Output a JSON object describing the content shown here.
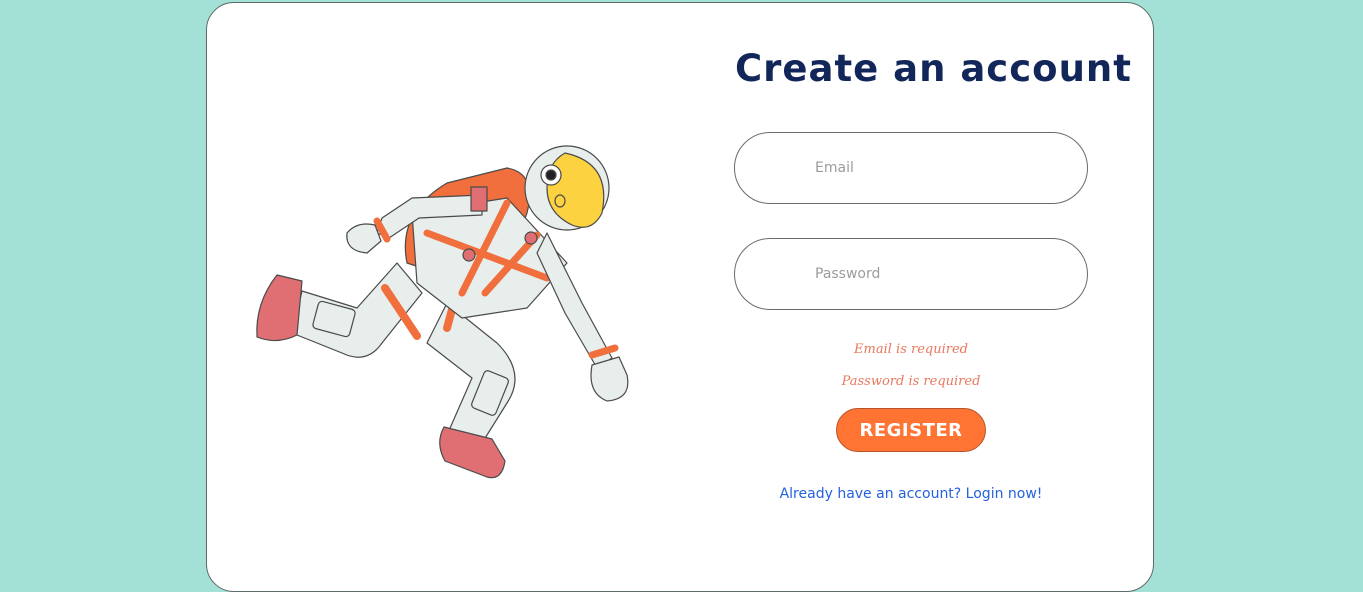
{
  "page": {
    "background_color": "#a3e0d6"
  },
  "form": {
    "title": "Create an account",
    "email_placeholder": "Email",
    "email_value": "",
    "password_placeholder": "Password",
    "password_value": "",
    "errors": {
      "email": "Email is required",
      "password": "Password is required"
    },
    "register_label": "REGISTER",
    "login_link_text": "Already have an account? Login now!"
  },
  "colors": {
    "title": "#12265a",
    "accent": "#ff7433",
    "error": "#e8775d",
    "link": "#2461e0"
  },
  "illustration": {
    "icon": "astronaut-illustration"
  }
}
